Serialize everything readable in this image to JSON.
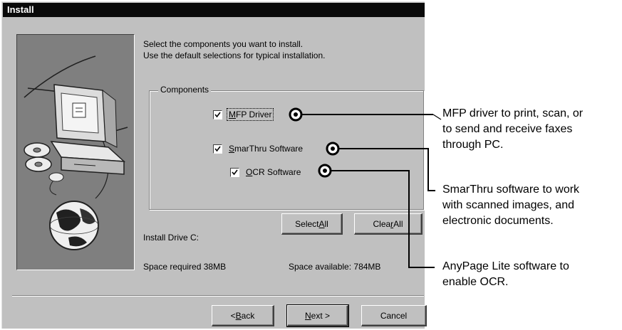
{
  "dialog": {
    "title": "Install",
    "instruction_line1": "Select the components you want to install.",
    "instruction_line2": "Use the default selections for typical installation.",
    "components_legend": "Components",
    "components": [
      {
        "label_pre": "",
        "label_accel": "M",
        "label_post": "FP Driver",
        "checked": true
      },
      {
        "label_pre": "",
        "label_accel": "S",
        "label_post": "marThru Software",
        "checked": true
      },
      {
        "label_pre": "",
        "label_accel": "O",
        "label_post": "CR Software",
        "checked": true
      }
    ],
    "install_drive": "Install Drive C:",
    "space_required": "Space required 38MB",
    "space_available": "Space available: 784MB",
    "buttons": {
      "select_all_pre": "Select ",
      "select_all_accel": "A",
      "select_all_post": "ll",
      "clear_all_pre": "Clea",
      "clear_all_accel": "r",
      "clear_all_post": " All",
      "back_pre": "< ",
      "back_accel": "B",
      "back_post": "ack",
      "next_accel": "N",
      "next_post": "ext >",
      "cancel": "Cancel"
    }
  },
  "callouts": {
    "mfp_line1": "MFP driver to print, scan, or",
    "mfp_line2": "to send and receive faxes",
    "mfp_line3": "through PC.",
    "smarthru_line1": "SmarThru software to work",
    "smarthru_line2": "with scanned images, and",
    "smarthru_line3": "electronic documents.",
    "anypage_line1": "AnyPage Lite software to",
    "anypage_line2": "enable OCR."
  },
  "colors": {
    "dialog_face": "#c0c0c0",
    "title_bar": "#0a0a0a",
    "illustration_bg": "#7f7f7f"
  }
}
